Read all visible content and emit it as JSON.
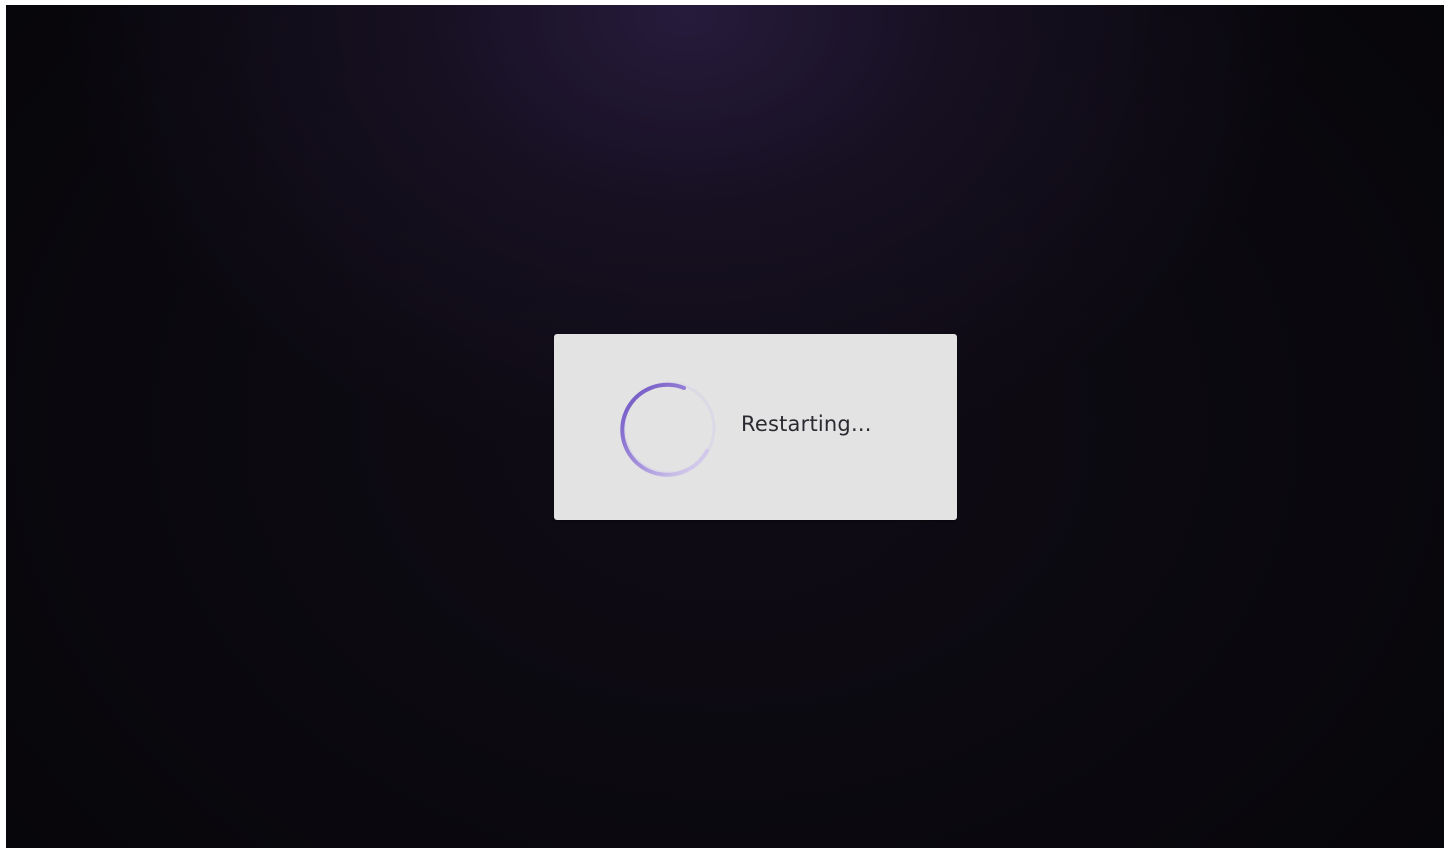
{
  "dialog": {
    "message": "Restarting..."
  },
  "spinner": {
    "icon": "loading-spinner-icon",
    "color": "#7b61c9",
    "track_color": "#d9d6e6"
  },
  "colors": {
    "background": "#0a080e",
    "dialog_background": "#e3e3e4",
    "text": "#2b2a30"
  }
}
